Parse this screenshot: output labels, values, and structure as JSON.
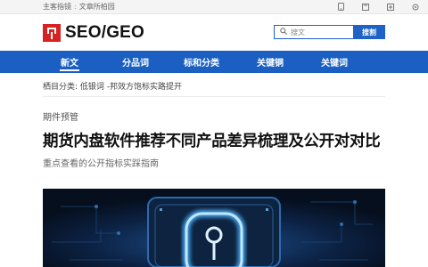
{
  "topbar": {
    "links": [
      "主客指镜",
      "文章所柏园"
    ]
  },
  "header": {
    "logo_text": "SEO/GEO",
    "search_placeholder": "搜文",
    "search_button": "搜割"
  },
  "nav": {
    "items": [
      {
        "label": "新文",
        "active": true
      },
      {
        "label": "分品词",
        "active": false
      },
      {
        "label": "标和分类",
        "active": false
      },
      {
        "label": "关键铜",
        "active": false
      },
      {
        "label": "关键词",
        "active": false
      }
    ]
  },
  "breadcrumb": "栖目分类:  低银词  -邦效方饱标实路提开",
  "article": {
    "kicker": "期件预管",
    "title": "期货内盘软件推荐不同产品差异梳理及公开对对比",
    "subtitle": "重点查看的公开指标实踩指南"
  },
  "colors": {
    "brand_blue": "#1a5fc1",
    "logo_red": "#d62222",
    "hero_glow": "#4fb6ff"
  }
}
